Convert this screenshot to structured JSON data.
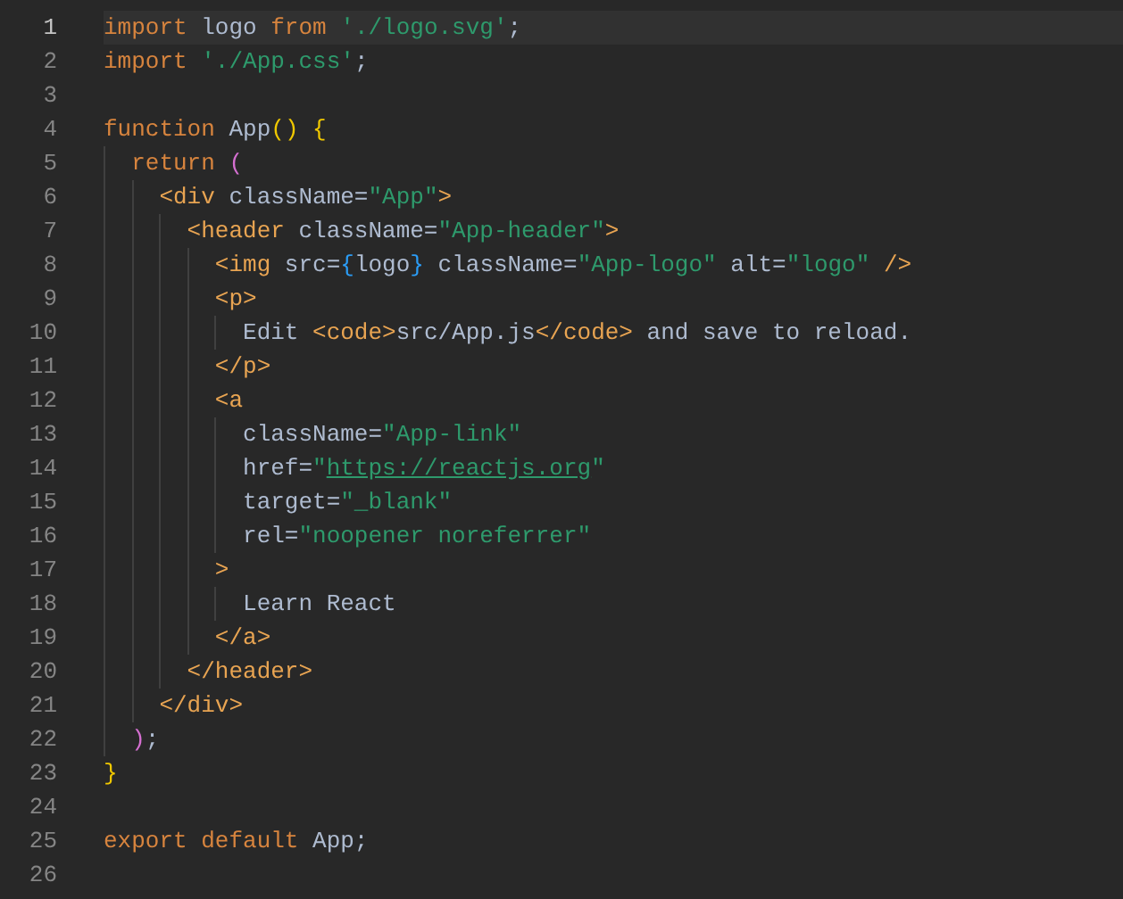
{
  "editor": {
    "lines": [
      {
        "number": "1",
        "selected": true,
        "tokens": [
          {
            "kind": "keyword",
            "text": "import"
          },
          {
            "kind": "text",
            "text": " logo "
          },
          {
            "kind": "keyword",
            "text": "from "
          },
          {
            "kind": "string",
            "text": "'./logo.svg'"
          },
          {
            "kind": "text",
            "text": ";"
          }
        ]
      },
      {
        "number": "2",
        "selected": false,
        "tokens": [
          {
            "kind": "keyword",
            "text": "import "
          },
          {
            "kind": "string",
            "text": "'./App.css'"
          },
          {
            "kind": "text",
            "text": ";"
          }
        ]
      },
      {
        "number": "3",
        "selected": false
      },
      {
        "number": "4",
        "selected": false,
        "tokens": [
          {
            "kind": "keyword",
            "text": "function"
          },
          {
            "kind": "text",
            "text": " App"
          },
          {
            "kind": "bracket1",
            "text": "() "
          },
          {
            "kind": "bracket1",
            "text": "{"
          }
        ]
      },
      {
        "number": "5",
        "selected": false,
        "tokens": [
          {
            "kind": "keyword",
            "text": "  return "
          },
          {
            "kind": "bracket2",
            "text": "("
          }
        ]
      },
      {
        "number": "6",
        "selected": false,
        "tokens": [
          {
            "kind": "tag",
            "text": "    <div"
          },
          {
            "kind": "text",
            "text": " className="
          },
          {
            "kind": "string",
            "text": "\"App\""
          },
          {
            "kind": "tag",
            "text": ">"
          }
        ]
      },
      {
        "number": "7",
        "selected": false,
        "tokens": [
          {
            "kind": "tag",
            "text": "      <header"
          },
          {
            "kind": "text",
            "text": " className="
          },
          {
            "kind": "string",
            "text": "\"App-header\""
          },
          {
            "kind": "tag",
            "text": ">"
          }
        ]
      },
      {
        "number": "8",
        "selected": false,
        "tokens": [
          {
            "kind": "tag",
            "text": "        <img"
          },
          {
            "kind": "text",
            "text": " src="
          },
          {
            "kind": "bracket3",
            "text": "{"
          },
          {
            "kind": "text",
            "text": "logo"
          },
          {
            "kind": "bracket3",
            "text": "}"
          },
          {
            "kind": "text",
            "text": " className="
          },
          {
            "kind": "string",
            "text": "\"App-logo\""
          },
          {
            "kind": "text",
            "text": " alt="
          },
          {
            "kind": "string",
            "text": "\"logo\" "
          },
          {
            "kind": "tag",
            "text": "/>"
          }
        ]
      },
      {
        "number": "9",
        "selected": false,
        "tokens": [
          {
            "kind": "tag",
            "text": "        <p>"
          }
        ]
      },
      {
        "number": "10",
        "selected": false,
        "tokens": [
          {
            "kind": "text",
            "text": "          Edit "
          },
          {
            "kind": "tag",
            "text": "<code>"
          },
          {
            "kind": "text",
            "text": "src/App.js"
          },
          {
            "kind": "tag",
            "text": "</code>"
          },
          {
            "kind": "text",
            "text": " and save to reload."
          }
        ]
      },
      {
        "number": "11",
        "selected": false,
        "tokens": [
          {
            "kind": "tag",
            "text": "        </p>"
          }
        ]
      },
      {
        "number": "12",
        "selected": false,
        "tokens": [
          {
            "kind": "tag",
            "text": "        <a"
          }
        ]
      },
      {
        "number": "13",
        "selected": false,
        "tokens": [
          {
            "kind": "text",
            "text": "          className="
          },
          {
            "kind": "string",
            "text": "\"App-link\""
          }
        ]
      },
      {
        "number": "14",
        "selected": false,
        "tokens": [
          {
            "kind": "text",
            "text": "          href="
          },
          {
            "kind": "string",
            "text": "\""
          },
          {
            "kind": "link",
            "text": "https://reactjs.org"
          },
          {
            "kind": "string",
            "text": "\""
          }
        ]
      },
      {
        "number": "15",
        "selected": false,
        "tokens": [
          {
            "kind": "text",
            "text": "          target="
          },
          {
            "kind": "string",
            "text": "\"_blank\""
          }
        ]
      },
      {
        "number": "16",
        "selected": false,
        "tokens": [
          {
            "kind": "text",
            "text": "          rel="
          },
          {
            "kind": "string",
            "text": "\"noopener noreferrer\""
          }
        ]
      },
      {
        "number": "17",
        "selected": false,
        "tokens": [
          {
            "kind": "tag",
            "text": "        >"
          }
        ]
      },
      {
        "number": "18",
        "selected": false,
        "tokens": [
          {
            "kind": "text",
            "text": "          Learn React"
          }
        ]
      },
      {
        "number": "19",
        "selected": false,
        "tokens": [
          {
            "kind": "tag",
            "text": "        </a>"
          }
        ]
      },
      {
        "number": "20",
        "selected": false,
        "tokens": [
          {
            "kind": "tag",
            "text": "      </header>"
          }
        ]
      },
      {
        "number": "21",
        "selected": false,
        "tokens": [
          {
            "kind": "tag",
            "text": "    </div>"
          }
        ]
      },
      {
        "number": "22",
        "selected": false,
        "tokens": [
          {
            "kind": "bracket2",
            "text": "  )"
          },
          {
            "kind": "text",
            "text": ";"
          }
        ]
      },
      {
        "number": "23",
        "selected": false,
        "tokens": [
          {
            "kind": "bracket1",
            "text": "}"
          }
        ]
      },
      {
        "number": "24",
        "selected": false
      },
      {
        "number": "25",
        "selected": false,
        "tokens": [
          {
            "kind": "keyword",
            "text": "export default"
          },
          {
            "kind": "text",
            "text": " App;"
          }
        ]
      },
      {
        "number": "26",
        "selected": false
      }
    ]
  }
}
